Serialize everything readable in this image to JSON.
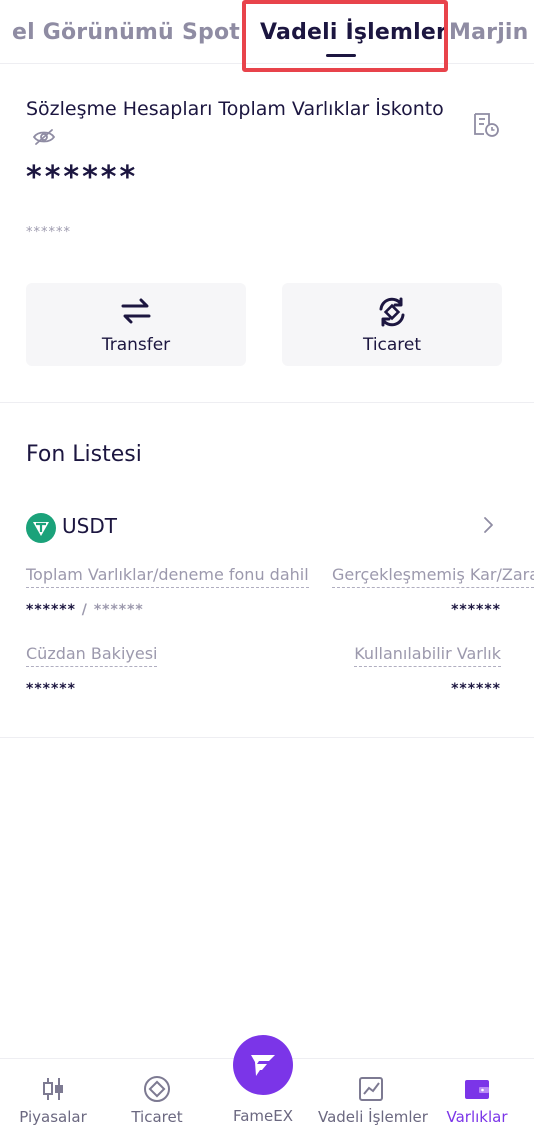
{
  "tabs": [
    {
      "label": "el Görünümü"
    },
    {
      "label": "Spot"
    },
    {
      "label": "Vadeli İşlemler"
    },
    {
      "label": "Marjin"
    }
  ],
  "summary": {
    "title": "Sözleşme Hesapları Toplam Varlıklar İskonto",
    "value": "******",
    "sub_value": "******"
  },
  "actions": {
    "transfer_label": "Transfer",
    "trade_label": "Ticaret"
  },
  "fund_list": {
    "title": "Fon Listesi",
    "coin": "USDT",
    "total_assets_label": "Toplam Varlıklar/deneme fonu dahil",
    "total_assets_value": "******",
    "trial_fund_value": "******",
    "unrealized_pnl_label": "Gerçekleşmemiş Kar/Zarar",
    "unrealized_pnl_value": "******",
    "wallet_balance_label": "Cüzdan Bakiyesi",
    "wallet_balance_value": "******",
    "available_label": "Kullanılabilir Varlık",
    "available_value": "******"
  },
  "bottom_nav": {
    "markets": "Piyasalar",
    "trade": "Ticaret",
    "center": "FameEX",
    "futures": "Vadeli İşlemler",
    "assets": "Varlıklar"
  },
  "colors": {
    "accent": "#7b35e8",
    "text": "#1c1640",
    "muted": "#9c99ad",
    "highlight": "#e8434b",
    "coin": "#1ba27a"
  },
  "icons": [
    "eye-off-icon",
    "record-icon",
    "transfer-icon",
    "trade-swap-icon",
    "usdt-icon",
    "chevron-right-icon",
    "candlestick-icon",
    "trade-target-icon",
    "fameex-logo-icon",
    "futures-chart-icon",
    "wallet-icon"
  ]
}
